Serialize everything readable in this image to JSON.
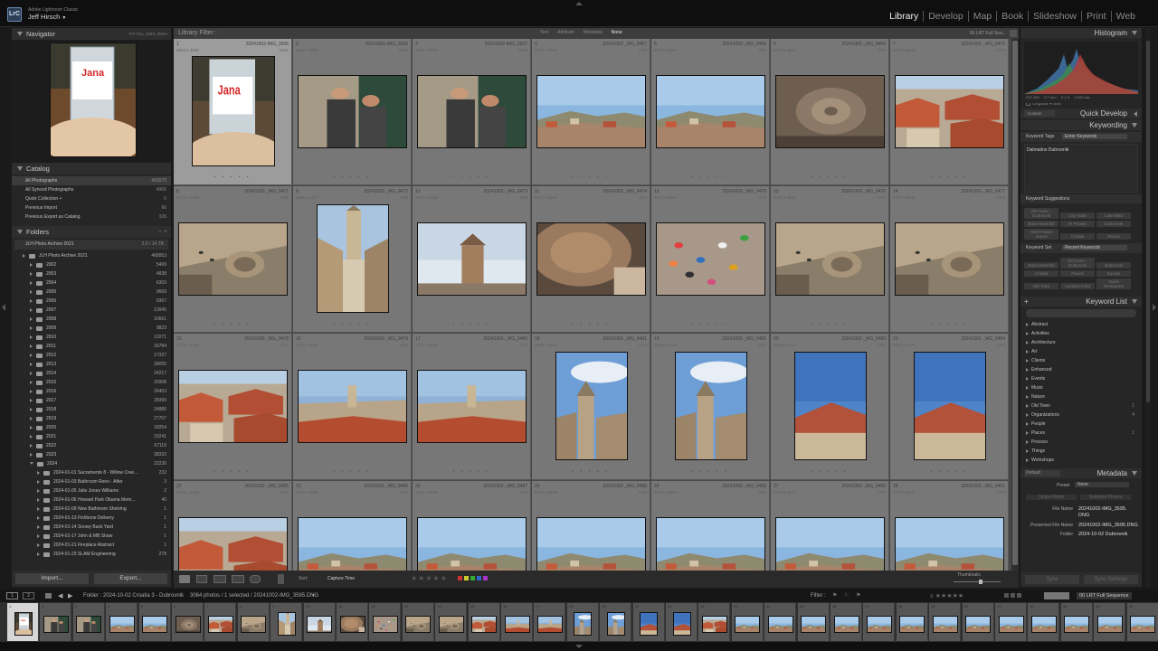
{
  "app": {
    "logo": "LrC",
    "name": "Adobe Lightroom Classic",
    "user": "Jeff Hirsch"
  },
  "modules": [
    "Library",
    "Develop",
    "Map",
    "Book",
    "Slideshow",
    "Print",
    "Web"
  ],
  "active_module": "Library",
  "navigator": {
    "title": "Navigator",
    "zoom_options": "FIT  FILL  100%  300%"
  },
  "catalog": {
    "title": "Catalog",
    "items": [
      {
        "label": "All Photographs",
        "count": "469970"
      },
      {
        "label": "All Synced Photographs",
        "count": "4906"
      },
      {
        "label": "Quick Collection +",
        "count": "0"
      },
      {
        "label": "Previous Import",
        "count": "66"
      },
      {
        "label": "Previous Export as Catalog",
        "count": "326"
      }
    ]
  },
  "folders": {
    "title": "Folders",
    "volume": "JLH Photo Archive 2021",
    "volume_stat": "2.6 / 14 TB",
    "root": "JLH Photo Archive 2021",
    "root_count": "468953",
    "years": [
      {
        "l": "2002",
        "n": "5499"
      },
      {
        "l": "2003",
        "n": "4838"
      },
      {
        "l": "2004",
        "n": "6303"
      },
      {
        "l": "2005",
        "n": "9669"
      },
      {
        "l": "2006",
        "n": "9367"
      },
      {
        "l": "2007",
        "n": "13945"
      },
      {
        "l": "2008",
        "n": "10661"
      },
      {
        "l": "2009",
        "n": "9823"
      },
      {
        "l": "2010",
        "n": "12071"
      },
      {
        "l": "2011",
        "n": "16784"
      },
      {
        "l": "2012",
        "n": "17337"
      },
      {
        "l": "2013",
        "n": "39055"
      },
      {
        "l": "2014",
        "n": "24217"
      },
      {
        "l": "2015",
        "n": "20908"
      },
      {
        "l": "2016",
        "n": "26403"
      },
      {
        "l": "2017",
        "n": "28399"
      },
      {
        "l": "2018",
        "n": "24886"
      },
      {
        "l": "2019",
        "n": "27707"
      },
      {
        "l": "2020",
        "n": "18254"
      },
      {
        "l": "2021",
        "n": "15241"
      },
      {
        "l": "2022",
        "n": "67119"
      },
      {
        "l": "2023",
        "n": "38332"
      },
      {
        "l": "2024",
        "n": "22236"
      }
    ],
    "sub": [
      {
        "l": "2024-01-01 Sacramento 8 - Willow Cree...",
        "n": "232"
      },
      {
        "l": "2024-01-03 Bathroom Reno - After",
        "n": "3"
      },
      {
        "l": "2024-01-05 Julie Jones Williams",
        "n": "2"
      },
      {
        "l": "2024-01-06 Howard Park Obama Mem...",
        "n": "40"
      },
      {
        "l": "2024-01-09 New Bathroom Shelving",
        "n": "1"
      },
      {
        "l": "2024-01-13 Fishbone Delivery",
        "n": "1"
      },
      {
        "l": "2024-01-14 Snowy Back Yard",
        "n": "1"
      },
      {
        "l": "2024-01-17 John & MB Shaw",
        "n": "1"
      },
      {
        "l": "2024-01-21 Fireplace Abstract",
        "n": "1"
      },
      {
        "l": "2024-01-23 SLAM Engineering",
        "n": "278"
      }
    ]
  },
  "left_buttons": {
    "import": "Import...",
    "export": "Export..."
  },
  "filter": {
    "title": "Library Filter :",
    "tabs": [
      "Text",
      "Attribute",
      "Metadata",
      "None"
    ],
    "preset": "00 LRT Full Sea..."
  },
  "grid": [
    {
      "i": "1",
      "f": "20241002-IMG_3595",
      "d": "3024 x 4032",
      "e": "DNG",
      "k": "jana",
      "o": "p",
      "sel": true
    },
    {
      "i": "2",
      "f": "20241002-IMG_3596",
      "d": "4032 x 3024",
      "e": "DNG",
      "k": "couple",
      "o": "l"
    },
    {
      "i": "3",
      "f": "20241002-IMG_3597",
      "d": "4032 x 3024",
      "e": "DNG",
      "k": "couple",
      "o": "l"
    },
    {
      "i": "4",
      "f": "20241002-_MG_9467",
      "d": "5472 x 3648",
      "e": "CR3",
      "k": "coast",
      "o": "l"
    },
    {
      "i": "5",
      "f": "20241002-_MG_9468",
      "d": "5472 x 3648",
      "e": "CR3",
      "k": "coast",
      "o": "l"
    },
    {
      "i": "6",
      "f": "20241002-_MG_9469",
      "d": "5472 x 3648",
      "e": "CR3",
      "k": "dome",
      "o": "l"
    },
    {
      "i": "7",
      "f": "20241002-_MG_9470",
      "d": "5472 x 3648",
      "e": "CR3",
      "k": "roofs",
      "o": "l"
    },
    {
      "i": "8",
      "f": "20241002-_MG_9471",
      "d": "5472 x 3648",
      "e": "CR3",
      "k": "plaza",
      "o": "l"
    },
    {
      "i": "9",
      "f": "20241002-_MG_9472",
      "d": "3648 x 5472",
      "e": "CR3",
      "k": "tower",
      "o": "p"
    },
    {
      "i": "10",
      "f": "20241002-_MG_9473",
      "d": "5472 x 3648",
      "e": "CR3",
      "k": "bell",
      "o": "l"
    },
    {
      "i": "11",
      "f": "20241002-_MG_9474",
      "d": "5472 x 3648",
      "e": "CR3",
      "k": "domeclose",
      "o": "l"
    },
    {
      "i": "12",
      "f": "20241002-_MG_9475",
      "d": "5472 x 3648",
      "e": "CR3",
      "k": "crowd",
      "o": "l"
    },
    {
      "i": "13",
      "f": "20241002-_MG_9476",
      "d": "5472 x 3648",
      "e": "CR3",
      "k": "plaza",
      "o": "l"
    },
    {
      "i": "14",
      "f": "20241002-_MG_9477",
      "d": "5472 x 3648",
      "e": "CR3",
      "k": "plaza",
      "o": "l"
    },
    {
      "i": "15",
      "f": "20241002-_MG_9478",
      "d": "5472 x 3648",
      "e": "CR3",
      "k": "roofs",
      "o": "l"
    },
    {
      "i": "16",
      "f": "20241002-_MG_9479",
      "d": "5472 x 3648",
      "e": "CR3",
      "k": "town",
      "o": "l"
    },
    {
      "i": "17",
      "f": "20241002-_MG_9480",
      "d": "5472 x 3648",
      "e": "CR3",
      "k": "town",
      "o": "l"
    },
    {
      "i": "18",
      "f": "20241002-_MG_9481",
      "d": "3648 x 5472",
      "e": "CR3",
      "k": "skytower",
      "o": "p"
    },
    {
      "i": "19",
      "f": "20241002-_MG_9482",
      "d": "3648 x 5472",
      "e": "CR3",
      "k": "skytower",
      "o": "p"
    },
    {
      "i": "20",
      "f": "20241002-_MG_9483",
      "d": "3648 x 5472",
      "e": "CR3",
      "k": "skyroof",
      "o": "p"
    },
    {
      "i": "21",
      "f": "20241002-_MG_9484",
      "d": "3648 x 5472",
      "e": "CR3",
      "k": "skyroof",
      "o": "p"
    },
    {
      "i": "22",
      "f": "20241002-_MG_9485",
      "d": "5472 x 3648",
      "e": "CR3",
      "k": "roofs",
      "o": "l"
    },
    {
      "i": "23",
      "f": "20241002-_MG_9486",
      "d": "5472 x 3648",
      "e": "CR3",
      "k": "coast",
      "o": "l"
    },
    {
      "i": "24",
      "f": "20241002-_MG_9487",
      "d": "5472 x 3648",
      "e": "CR3",
      "k": "coast",
      "o": "l"
    },
    {
      "i": "25",
      "f": "20241002-_MG_9488",
      "d": "5472 x 3648",
      "e": "CR3",
      "k": "coast",
      "o": "l"
    },
    {
      "i": "26",
      "f": "20241002-_MG_9489",
      "d": "5472 x 3648",
      "e": "CR3",
      "k": "coast",
      "o": "l"
    },
    {
      "i": "27",
      "f": "20241002-_MG_9490",
      "d": "5472 x 3648",
      "e": "CR3",
      "k": "coast",
      "o": "l"
    },
    {
      "i": "28",
      "f": "20241002-_MG_9491",
      "d": "5472 x 3648",
      "e": "CR3",
      "k": "coast",
      "o": "l"
    }
  ],
  "toolbar": {
    "sort_label": "Sort:",
    "sort_value": "Capture Time",
    "thumbs_label": "Thumbnails"
  },
  "right": {
    "histogram": "Histogram",
    "hist_info": "ISO 160     5.7 mm     f/ 1.5     1/100 sec",
    "original_photo": "Original Photo",
    "quick_dev": "Quick Develop",
    "custom": "Custom",
    "keywording": "Keywording",
    "kw_tags_label": "Keyword Tags",
    "kw_tags_value": "Enter Keywords",
    "kw_text": "Dalmatino Dubrovnik",
    "kw_sugg": "Keyword Suggestions",
    "sugg": [
      "Old Town – Dubrovnik",
      "City Walls",
      "Lake Bled",
      "Buka Waterfall",
      "Pr Pondel",
      "Dubrovnik",
      "Hotel Radon Airport",
      "Croatia",
      "Places"
    ],
    "kw_set": "Keyword Set",
    "kw_set_value": "Recent Keywords",
    "set": [
      "Buka Waterfall",
      "Old Town – Dubrovnik",
      "Dubrovnik",
      "Croatia",
      "Places",
      "Europe",
      "Old Town",
      "Lambert Field",
      "Starlit Restaurant"
    ],
    "kw_list": "Keyword List",
    "list": [
      {
        "l": "Abstract",
        "n": ""
      },
      {
        "l": "Activities",
        "n": ""
      },
      {
        "l": "Architecture",
        "n": ""
      },
      {
        "l": "Art",
        "n": ""
      },
      {
        "l": "Clients",
        "n": ""
      },
      {
        "l": "Enhanced",
        "n": ""
      },
      {
        "l": "Events",
        "n": ""
      },
      {
        "l": "Music",
        "n": ""
      },
      {
        "l": "Nature",
        "n": ""
      },
      {
        "l": "Old Town",
        "n": "1"
      },
      {
        "l": "Organizations",
        "n": "4"
      },
      {
        "l": "People",
        "n": ""
      },
      {
        "l": "Places",
        "n": "1"
      },
      {
        "l": "Process",
        "n": ""
      },
      {
        "l": "Things",
        "n": ""
      },
      {
        "l": "Workshops",
        "n": ""
      }
    ],
    "metadata": "Metadata",
    "default": "Default",
    "preset_label": "Preset",
    "preset_value": "None",
    "target_photo": "Target Photo",
    "selected_photos": "Selected Photos",
    "file_name_label": "File Name",
    "file_name_value": "20241002-IMG_3595.DNG",
    "pres_label": "Preserved File Name",
    "pres_value": "20241002-IMG_3595.DNG",
    "folder_label": "Folder",
    "folder_value": "2024-10-02 Dubrovnik",
    "sync": "Sync",
    "sync_settings": "Sync Settings"
  },
  "filmbar": {
    "source": "Folder : 2024-10-02 Croatia 3 - Dubrovnik",
    "count": "3064 photos / 1 selected / 20241002-IMG_3595.DNG",
    "filter_label": "Filter :",
    "preset": "00 LRT Full Sequence"
  },
  "film": [
    {
      "n": "1",
      "k": "jana",
      "sel": true
    },
    {
      "n": "2",
      "k": "couple"
    },
    {
      "n": "3",
      "k": "couple"
    },
    {
      "n": "4",
      "k": "coast"
    },
    {
      "n": "5",
      "k": "coast"
    },
    {
      "n": "6",
      "k": "dome"
    },
    {
      "n": "7",
      "k": "roofs"
    },
    {
      "n": "8",
      "k": "plaza"
    },
    {
      "n": "9",
      "k": "tower"
    },
    {
      "n": "10",
      "k": "bell"
    },
    {
      "n": "11",
      "k": "domeclose"
    },
    {
      "n": "12",
      "k": "crowd"
    },
    {
      "n": "13",
      "k": "plaza"
    },
    {
      "n": "14",
      "k": "plaza"
    },
    {
      "n": "15",
      "k": "roofs"
    },
    {
      "n": "16",
      "k": "town"
    },
    {
      "n": "17",
      "k": "town"
    },
    {
      "n": "18",
      "k": "skytower"
    },
    {
      "n": "19",
      "k": "skytower"
    },
    {
      "n": "20",
      "k": "skyroof"
    },
    {
      "n": "21",
      "k": "skyroof"
    },
    {
      "n": "22",
      "k": "roofs"
    },
    {
      "n": "23",
      "k": "coast"
    },
    {
      "n": "24",
      "k": "coast"
    },
    {
      "n": "25",
      "k": "coast"
    },
    {
      "n": "26",
      "k": "coast"
    },
    {
      "n": "27",
      "k": "coast"
    },
    {
      "n": "28",
      "k": "coast"
    },
    {
      "n": "29",
      "k": "coast"
    },
    {
      "n": "30",
      "k": "coast"
    },
    {
      "n": "31",
      "k": "coast"
    },
    {
      "n": "32",
      "k": "coast"
    },
    {
      "n": "33",
      "k": "coast"
    },
    {
      "n": "34",
      "k": "coast"
    },
    {
      "n": "35",
      "k": "coast"
    }
  ]
}
